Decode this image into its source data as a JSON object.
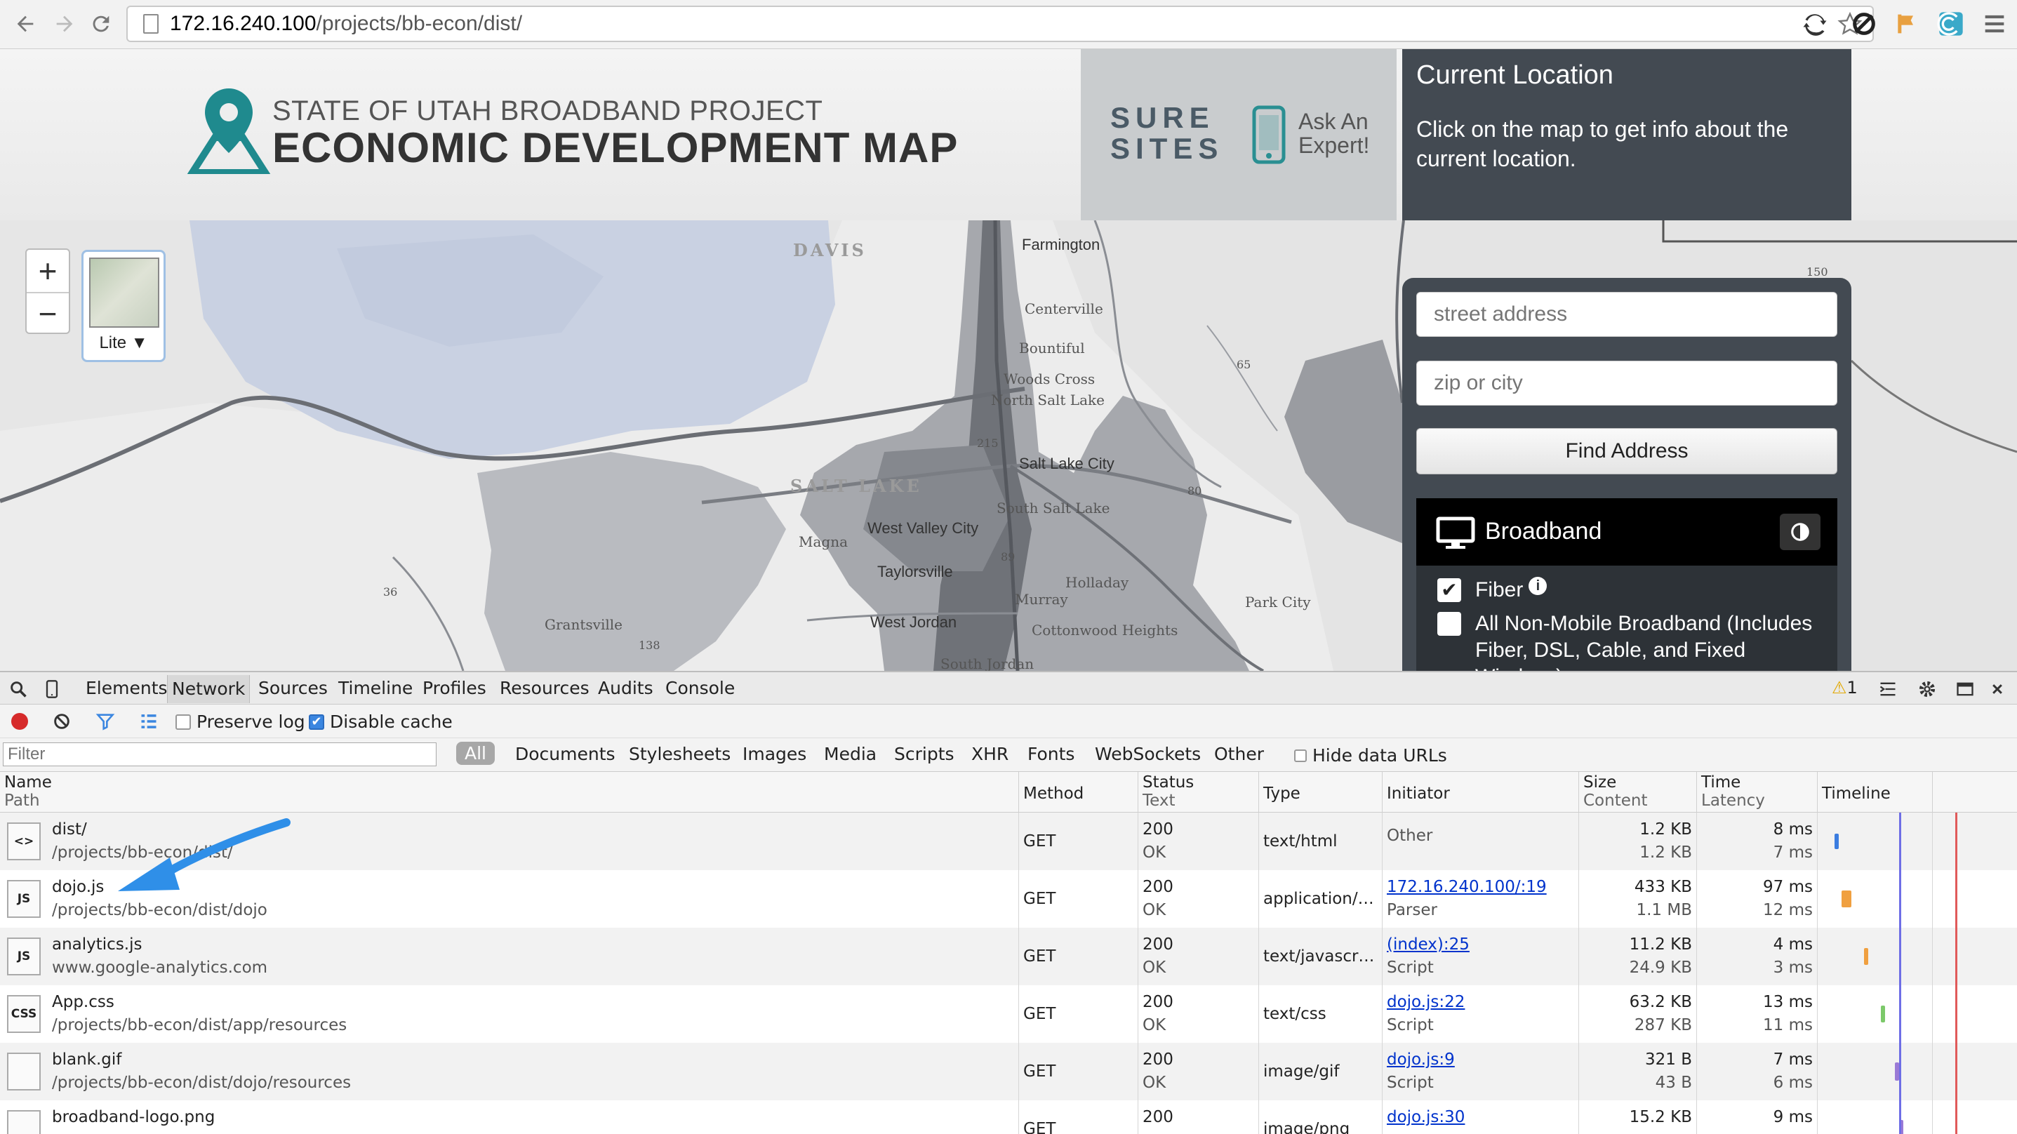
{
  "browser": {
    "url_host": "172.16.240.100",
    "url_path": "/projects/bb-econ/dist/"
  },
  "header": {
    "title_small": "STATE OF UTAH BROADBAND PROJECT",
    "title_big": "ECONOMIC DEVELOPMENT MAP",
    "sure_sites_line1": "SURE",
    "sure_sites_line2": "SITES",
    "ask_expert_line1": "Ask An",
    "ask_expert_line2": "Expert!"
  },
  "location_panel": {
    "title": "Current Location",
    "text": "Click on the map to get info about the current location."
  },
  "map": {
    "labels": {
      "davis": "DAVIS",
      "farmington": "Farmington",
      "centerville": "Centerville",
      "bountiful": "Bountiful",
      "woods_cross": "Woods Cross",
      "north_salt_lake": "North Salt Lake",
      "salt_lake_city": "Salt Lake City",
      "salt_lake": "SALT LAKE",
      "south_salt_lake": "South Salt Lake",
      "west_valley_city": "West Valley City",
      "magna": "Magna",
      "taylorsville": "Taylorsville",
      "holladay": "Holladay",
      "murray": "Murray",
      "park_city": "Park City",
      "west_jordan": "West Jordan",
      "cottonwood_heights": "Cottonwood Heights",
      "grantsville": "Grantsville",
      "south_jordan": "South Jordan",
      "r65": "65",
      "r150": "150",
      "r215": "215",
      "r89": "89",
      "r80": "80",
      "r36": "36",
      "r138": "138"
    },
    "zoom_in": "+",
    "zoom_out": "−",
    "basemap_label": "Lite ▼"
  },
  "search": {
    "street_placeholder": "street address",
    "zip_placeholder": "zip or city",
    "find_button": "Find Address",
    "broadband_title": "Broadband",
    "fiber_label": "Fiber",
    "info_glyph": "i",
    "all_nonmobile_label": "All Non-Mobile Broadband (Includes Fiber, DSL, Cable, and Fixed Wireless)"
  },
  "devtools": {
    "tabs": [
      "Elements",
      "Network",
      "Sources",
      "Timeline",
      "Profiles",
      "Resources",
      "Audits",
      "Console"
    ],
    "active_tab": "Network",
    "warning_count": "1",
    "preserve_log": "Preserve log",
    "disable_cache": "Disable cache",
    "filter_placeholder": "Filter",
    "types": [
      "All",
      "Documents",
      "Stylesheets",
      "Images",
      "Media",
      "Scripts",
      "XHR",
      "Fonts",
      "WebSockets",
      "Other"
    ],
    "hide_data_urls": "Hide data URLs",
    "columns": {
      "name": "Name",
      "path": "Path",
      "method": "Method",
      "status": "Status",
      "text": "Text",
      "type": "Type",
      "initiator": "Initiator",
      "size": "Size",
      "content": "Content",
      "time": "Time",
      "latency": "Latency",
      "timeline": "Timeline"
    },
    "rows": [
      {
        "name": "dist/",
        "path": "/projects/bb-econ/dist/",
        "method": "GET",
        "status": "200",
        "text": "OK",
        "type": "text/html",
        "initiator": "Other",
        "initiator_sub": "",
        "size": "1.2 KB",
        "content": "1.2 KB",
        "time": "8 ms",
        "latency": "7 ms",
        "icon": "html-icon",
        "icon_glyph": "<>",
        "bar_color": "#3b7de0"
      },
      {
        "name": "dojo.js",
        "path": "/projects/bb-econ/dist/dojo",
        "method": "GET",
        "status": "200",
        "text": "OK",
        "type": "application/…",
        "initiator": "172.16.240.100/:19",
        "initiator_sub": "Parser",
        "size": "433 KB",
        "content": "1.1 MB",
        "time": "97 ms",
        "latency": "12 ms",
        "icon": "js-icon",
        "icon_glyph": "JS",
        "bar_color": "#f0a040"
      },
      {
        "name": "analytics.js",
        "path": "www.google-analytics.com",
        "method": "GET",
        "status": "200",
        "text": "OK",
        "type": "text/javascr…",
        "initiator": "(index):25",
        "initiator_sub": "Script",
        "size": "11.2 KB",
        "content": "24.9 KB",
        "time": "4 ms",
        "latency": "3 ms",
        "icon": "js-icon",
        "icon_glyph": "JS",
        "bar_color": "#f0a040"
      },
      {
        "name": "App.css",
        "path": "/projects/bb-econ/dist/app/resources",
        "method": "GET",
        "status": "200",
        "text": "OK",
        "type": "text/css",
        "initiator": "dojo.js:22",
        "initiator_sub": "Script",
        "size": "63.2 KB",
        "content": "287 KB",
        "time": "13 ms",
        "latency": "11 ms",
        "icon": "css-icon",
        "icon_glyph": "CSS",
        "bar_color": "#7cc96a"
      },
      {
        "name": "blank.gif",
        "path": "/projects/bb-econ/dist/dojo/resources",
        "method": "GET",
        "status": "200",
        "text": "OK",
        "type": "image/gif",
        "initiator": "dojo.js:9",
        "initiator_sub": "Script",
        "size": "321 B",
        "content": "43 B",
        "time": "7 ms",
        "latency": "6 ms",
        "icon": "image-icon",
        "icon_glyph": "",
        "bar_color": "#9a7ad6"
      },
      {
        "name": "broadband-logo.png",
        "path": "",
        "method": "GET",
        "status": "200",
        "text": "",
        "type": "image/png",
        "initiator": "dojo.js:30",
        "initiator_sub": "",
        "size": "15.2 KB",
        "content": "",
        "time": "9 ms",
        "latency": "",
        "icon": "image-icon",
        "icon_glyph": "",
        "bar_color": "#9a7ad6"
      }
    ]
  },
  "colors": {
    "accent_teal": "#1f8a8e",
    "panel_dark": "#434a52",
    "link": "#0033cc",
    "annotation_arrow": "#2f8fe8"
  }
}
